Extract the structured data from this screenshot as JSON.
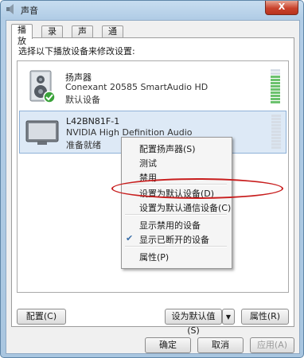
{
  "window": {
    "title": "声音",
    "close_glyph": "X"
  },
  "tabs": [
    {
      "label": "播放",
      "active": true
    },
    {
      "label": "录制",
      "active": false
    },
    {
      "label": "声音",
      "active": false
    },
    {
      "label": "通信",
      "active": false
    }
  ],
  "instruction": "选择以下播放设备来修改设置:",
  "devices": [
    {
      "name": "扬声器",
      "description": "Conexant 20585 SmartAudio HD",
      "status": "默认设备",
      "icon": "speaker-icon",
      "default": true
    },
    {
      "name": "L42BN81F-1",
      "description": "NVIDIA High Definition Audio",
      "status": "准备就绪",
      "icon": "tv-monitor-icon",
      "selected": true
    }
  ],
  "context_menu": {
    "items": [
      {
        "label": "配置扬声器(S)"
      },
      {
        "label": "测试"
      },
      {
        "label": "禁用"
      },
      {
        "label": "设置为默认设备(D)",
        "bold": true
      },
      {
        "label": "设置为默认通信设备(C)"
      },
      {
        "label": "显示禁用的设备"
      },
      {
        "label": "显示已断开的设备",
        "checked": true
      },
      {
        "label": "属性(P)"
      }
    ]
  },
  "panel_buttons": {
    "configure": "配置(C)",
    "set_default": "设为默认值(S)",
    "properties": "属性(R)"
  },
  "dialog_buttons": {
    "ok": "确定",
    "cancel": "取消",
    "apply": "应用(A)"
  },
  "colors": {
    "highlight_circle": "#c81e1e",
    "default_check": "#3aa23a"
  }
}
